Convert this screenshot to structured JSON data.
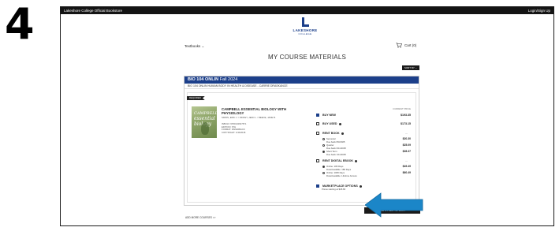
{
  "step_number": "4",
  "topbar": {
    "store_name": "Lakeshore College Official Bookstore",
    "login_label": "Login/Sign Up"
  },
  "logo": {
    "name": "LAKESHORE",
    "sub": "COLLEGE"
  },
  "nav": {
    "textbooks_label": "Textbooks",
    "cart_label": "Cart (0)"
  },
  "page_title": "MY COURSE MATERIALS",
  "sort_label": "SORT BY",
  "course": {
    "code": "BIO 104 ONLIN",
    "term": "Fall 2024",
    "description": "BIO 104 ONLIN HUMAN BODY IN HEALTH & DISEASE - CARRIE DRASKANCE"
  },
  "required_tag": "REQUIRED",
  "book": {
    "cover_line1": "CAMPBELL",
    "cover_line2": "essential biology",
    "title": "CAMPBELL ESSENTIAL BIOLOGY WITH PHYSIOLOGY",
    "authors": "SIMON, ERIC J. / DICKEY, JEAN L. / REECE, JANE B.",
    "isbn": "ISBN13: 9780134637571",
    "edition": "EDITION: 6TH",
    "format": "FORMAT: PAPERBACK",
    "copyright": "COPYRIGHT: 1/30/2018"
  },
  "price_header": "CURRENT PRICE",
  "options": {
    "buy_new": {
      "label": "BUY NEW",
      "price": "$193.35",
      "checked": true
    },
    "buy_used": {
      "label": "BUY USED",
      "price": "$173.15",
      "checked": false
    },
    "rent_book": {
      "label": "RENT BOOK",
      "dash": "—",
      "terms": [
        {
          "name": "Semester",
          "due": "Due back 8/3/2025",
          "price": "$20.30",
          "selected": false
        },
        {
          "name": "Quarter",
          "due": "Due back 6/11/2025",
          "price": "$25.09",
          "selected": false
        },
        {
          "name": "Short Term",
          "due": "Due back 1/11/2025",
          "price": "$28.37",
          "selected": true
        }
      ]
    },
    "rent_ebook": {
      "label": "RENT DIGITAL EBOOK",
      "dash": "—",
      "terms": [
        {
          "name": "Online: 180 Days",
          "detail": "Downloadable: 180 Days",
          "price": "$49.49",
          "selected": true
        },
        {
          "name": "Online: 1825 Days",
          "detail": "Downloadable: Lifetime Access",
          "price": "$60.49",
          "selected": false
        }
      ]
    },
    "marketplace": {
      "label": "MARKETPLACE OPTIONS",
      "note": "Prices starting at $45.80",
      "checked": true
    }
  },
  "add_to_cart_label": "ADD 1 ITEM TO CART",
  "add_more_label": "ADD MORE COURSES >>",
  "colors": {
    "brand_blue": "#1c3f8a",
    "arrow_blue": "#1b86c8",
    "dark": "#1a1a1a"
  }
}
